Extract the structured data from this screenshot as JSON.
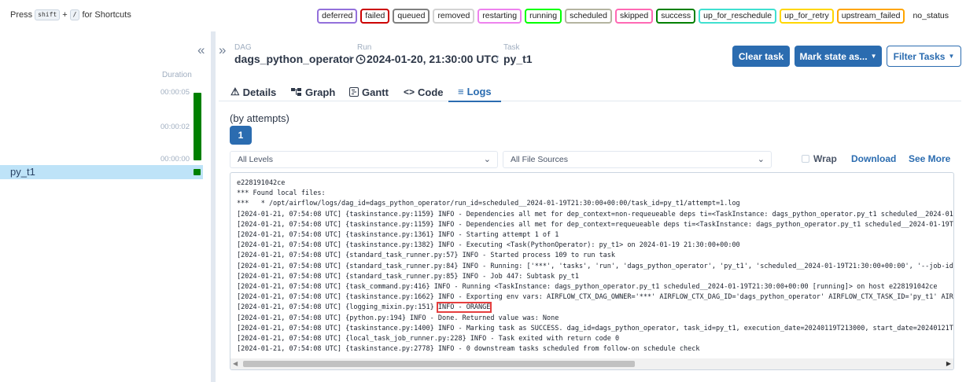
{
  "shortcuts": {
    "press": "Press",
    "key1": "shift",
    "plus": "+",
    "key2": "/",
    "suffix": "for Shortcuts"
  },
  "legend": [
    {
      "label": "deferred",
      "color": "#9370db"
    },
    {
      "label": "failed",
      "color": "#cc0000"
    },
    {
      "label": "queued",
      "color": "#808080"
    },
    {
      "label": "removed",
      "color": "#d3d3d3"
    },
    {
      "label": "restarting",
      "color": "#ee82ee"
    },
    {
      "label": "running",
      "color": "#00ff00"
    },
    {
      "label": "scheduled",
      "color": "#b4b4a0"
    },
    {
      "label": "skipped",
      "color": "#ff69b4"
    },
    {
      "label": "success",
      "color": "#008000"
    },
    {
      "label": "up_for_reschedule",
      "color": "#40e0d0"
    },
    {
      "label": "up_for_retry",
      "color": "#ffd700"
    },
    {
      "label": "upstream_failed",
      "color": "#ffa500"
    },
    {
      "label": "no_status",
      "color": "transparent"
    }
  ],
  "left": {
    "duration_label": "Duration",
    "ticks": [
      "00:00:05",
      "00:00:02",
      "00:00:00"
    ],
    "task_name": "py_t1",
    "success_color": "#008000"
  },
  "breadcrumb": {
    "dag_label": "DAG",
    "dag_value": "dags_python_operator",
    "run_label": "Run",
    "run_value": "2024-01-20, 21:30:00 UTC",
    "task_label": "Task",
    "task_value": "py_t1",
    "sep": "/"
  },
  "buttons": {
    "clear": "Clear task",
    "mark": "Mark state as...",
    "filter": "Filter Tasks"
  },
  "tabs": [
    {
      "label": "Details",
      "icon": "warning-icon"
    },
    {
      "label": "Graph",
      "icon": "graph-icon"
    },
    {
      "label": "Gantt",
      "icon": "gantt-icon"
    },
    {
      "label": "Code",
      "icon": "code-icon"
    },
    {
      "label": "Logs",
      "icon": "list-icon"
    }
  ],
  "logs": {
    "attempts_label": "(by attempts)",
    "attempt_number": "1",
    "level_select": "All Levels",
    "source_select": "All File Sources",
    "wrap_label": "Wrap",
    "download": "Download",
    "see_more": "See More",
    "lines": [
      "e228191042ce",
      "*** Found local files:",
      "***   * /opt/airflow/logs/dag_id=dags_python_operator/run_id=scheduled__2024-01-19T21:30:00+00:00/task_id=py_t1/attempt=1.log",
      "[2024-01-21, 07:54:08 UTC] {taskinstance.py:1159} INFO - Dependencies all met for dep_context=non-requeueable deps ti=<TaskInstance: dags_python_operator.py_t1 scheduled__2024-01",
      "[2024-01-21, 07:54:08 UTC] {taskinstance.py:1159} INFO - Dependencies all met for dep_context=requeueable deps ti=<TaskInstance: dags_python_operator.py_t1 scheduled__2024-01-19T",
      "[2024-01-21, 07:54:08 UTC] {taskinstance.py:1361} INFO - Starting attempt 1 of 1",
      "[2024-01-21, 07:54:08 UTC] {taskinstance.py:1382} INFO - Executing <Task(PythonOperator): py_t1> on 2024-01-19 21:30:00+00:00",
      "[2024-01-21, 07:54:08 UTC] {standard_task_runner.py:57} INFO - Started process 109 to run task",
      "[2024-01-21, 07:54:08 UTC] {standard_task_runner.py:84} INFO - Running: ['***', 'tasks', 'run', 'dags_python_operator', 'py_t1', 'scheduled__2024-01-19T21:30:00+00:00', '--job-id",
      "[2024-01-21, 07:54:08 UTC] {standard_task_runner.py:85} INFO - Job 447: Subtask py_t1",
      "[2024-01-21, 07:54:08 UTC] {task_command.py:416} INFO - Running <TaskInstance: dags_python_operator.py_t1 scheduled__2024-01-19T21:30:00+00:00 [running]> on host e228191042ce",
      "[2024-01-21, 07:54:08 UTC] {taskinstance.py:1662} INFO - Exporting env vars: AIRFLOW_CTX_DAG_OWNER='***' AIRFLOW_CTX_DAG_ID='dags_python_operator' AIRFLOW_CTX_TASK_ID='py_t1' AIR",
      "[2024-01-21, 07:54:08 UTC] {logging_mixin.py:151} ",
      "[2024-01-21, 07:54:08 UTC] {python.py:194} INFO - Done. Returned value was: None",
      "[2024-01-21, 07:54:08 UTC] {taskinstance.py:1400} INFO - Marking task as SUCCESS. dag_id=dags_python_operator, task_id=py_t1, execution_date=20240119T213000, start_date=20240121T",
      "[2024-01-21, 07:54:08 UTC] {local_task_job_runner.py:228} INFO - Task exited with return code 0",
      "[2024-01-21, 07:54:08 UTC] {taskinstance.py:2778} INFO - 0 downstream tasks scheduled from follow-on schedule check"
    ],
    "highlight_text": "INFO - ORANGE",
    "highlight_line": 12
  }
}
